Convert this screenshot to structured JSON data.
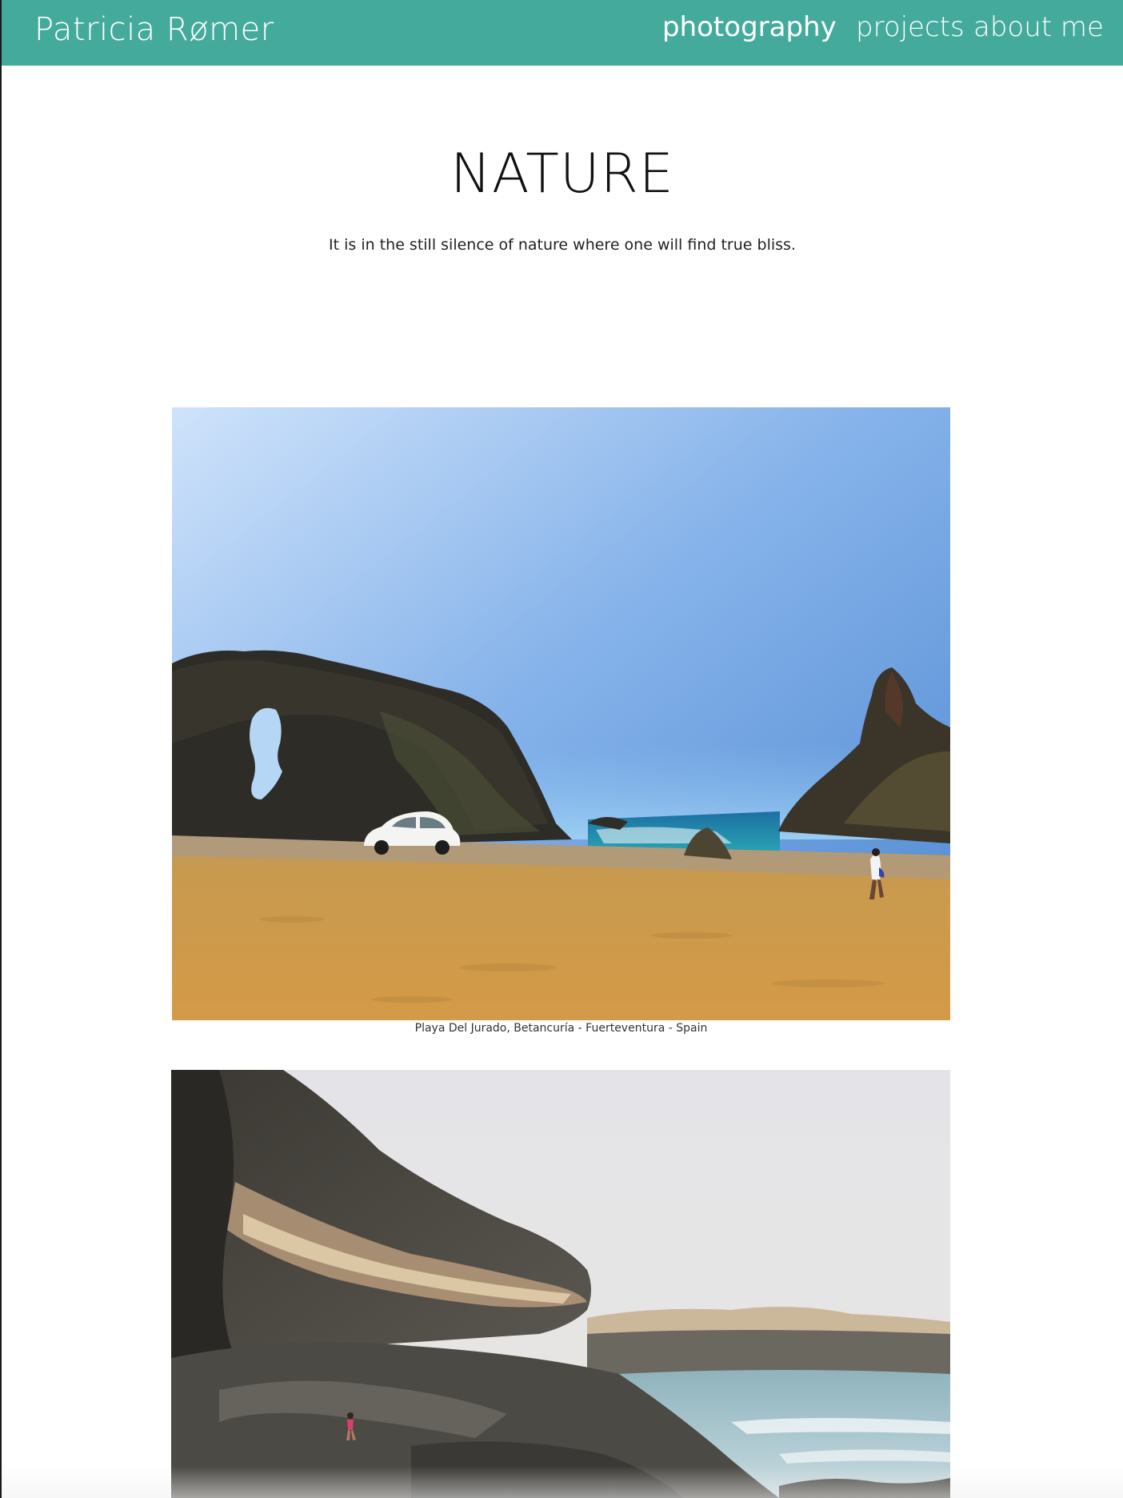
{
  "navbar": {
    "brand": "Patricia Rømer",
    "links": [
      {
        "label": "photography",
        "active": true
      },
      {
        "label": "projects",
        "active": false
      },
      {
        "label": "about me",
        "active": false
      }
    ],
    "background_color": "#44ab9c"
  },
  "main": {
    "title": "NATURE",
    "tagline": "It is in the still silence of nature where one will find true bliss.",
    "photos": [
      {
        "caption": "Playa Del Jurado, Betancuría - Fuerteventura - Spain"
      },
      {
        "caption": ""
      }
    ]
  }
}
